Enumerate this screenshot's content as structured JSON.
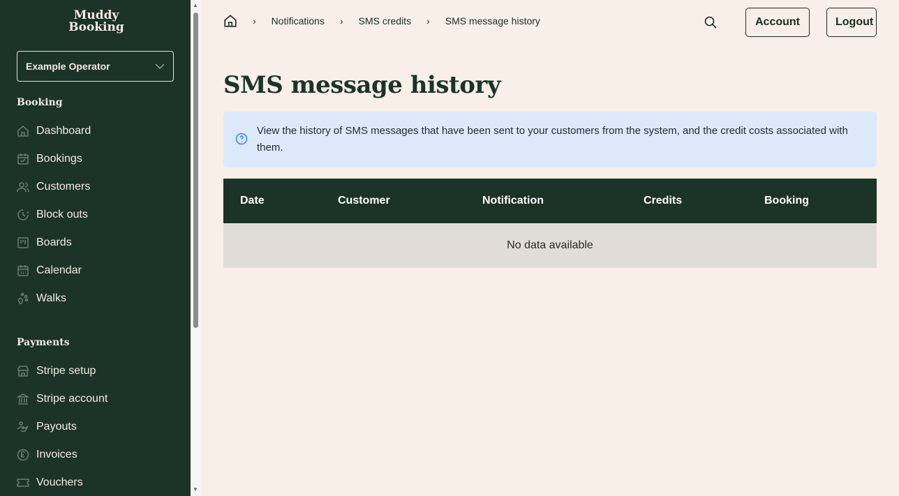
{
  "sidebar": {
    "logo": [
      "Muddy",
      "Booking"
    ],
    "operator": "Example Operator",
    "sections": [
      {
        "title": "Booking",
        "items": [
          "Dashboard",
          "Bookings",
          "Customers",
          "Block outs",
          "Boards",
          "Calendar",
          "Walks"
        ]
      },
      {
        "title": "Payments",
        "items": [
          "Stripe setup",
          "Stripe account",
          "Payouts",
          "Invoices",
          "Vouchers"
        ]
      }
    ]
  },
  "breadcrumb": [
    "Notifications",
    "SMS credits",
    "SMS message history"
  ],
  "header": {
    "account": "Account",
    "logout": "Logout"
  },
  "page": {
    "title": "SMS message history",
    "info": "View the history of SMS messages that have been sent to your customers from the system, and the credit costs associated with them."
  },
  "table": {
    "columns": [
      "Date",
      "Customer",
      "Notification",
      "Credits",
      "Booking"
    ],
    "empty": "No data available"
  }
}
